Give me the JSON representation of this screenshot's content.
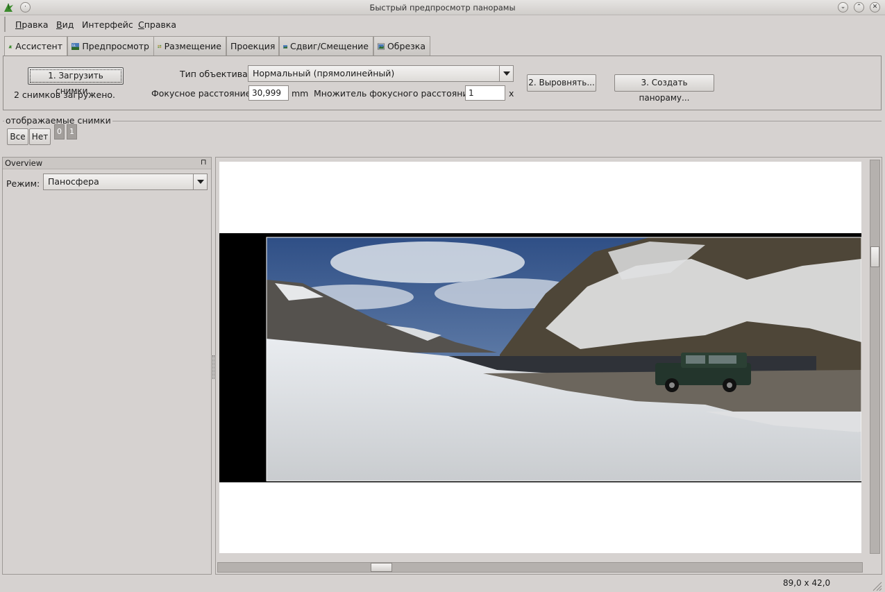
{
  "window": {
    "title": "Быстрый предпросмотр панорамы"
  },
  "menu": [
    {
      "pre": "",
      "u": "П",
      "post": "равка"
    },
    {
      "pre": "",
      "u": "В",
      "post": "ид"
    },
    {
      "pre": "Интерфейс",
      "u": "",
      "post": ""
    },
    {
      "pre": "",
      "u": "С",
      "post": "правка"
    }
  ],
  "tabs": [
    {
      "label": "Ассистент",
      "icon": "assistant-icon",
      "active": true
    },
    {
      "label": "Предпросмотр",
      "icon": "gl-preview-icon",
      "active": false
    },
    {
      "label": "Размещение",
      "icon": "layout-icon",
      "active": false
    },
    {
      "label": "Проекция",
      "icon": "",
      "active": false
    },
    {
      "label": "Сдвиг/Смещение",
      "icon": "move-icon",
      "active": false
    },
    {
      "label": "Обрезка",
      "icon": "crop-icon",
      "active": false
    }
  ],
  "assistant": {
    "load_button": "1. Загрузить снимки...",
    "loaded_status": "2 снимков загружено.",
    "lens_type_label": "Тип объектива:",
    "lens_type_value": "Нормальный (прямолинейный)",
    "focal_length_label": "Фокусное расстояние:",
    "focal_length_value": "30,999",
    "focal_length_unit": "mm",
    "crop_factor_label": "Множитель фокусного расстояния:",
    "crop_factor_value": "1",
    "crop_factor_unit": "x",
    "align_button": "2. Выровнять...",
    "create_button": "3. Создать панораму..."
  },
  "displayed_images": {
    "legend": "отображаемые снимки",
    "all_button": "Все",
    "none_button": "Нет",
    "images": [
      "0",
      "1"
    ]
  },
  "overview": {
    "title": "Overview",
    "mode_label": "Режим:",
    "mode_value": "Паносфера"
  },
  "status": {
    "fov": "89,0 x 42,0"
  }
}
